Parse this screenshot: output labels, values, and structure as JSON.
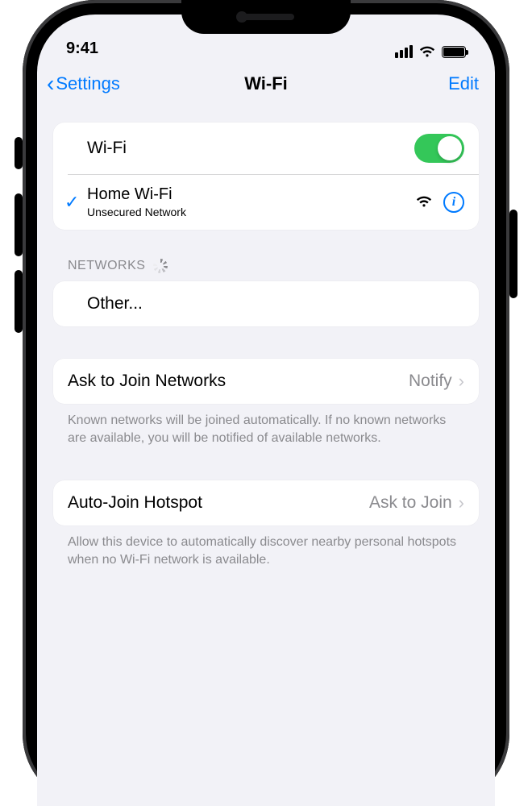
{
  "status": {
    "time": "9:41"
  },
  "nav": {
    "back_label": "Settings",
    "title": "Wi-Fi",
    "edit_label": "Edit"
  },
  "wifi_toggle": {
    "label": "Wi-Fi",
    "on": true
  },
  "connected": {
    "name": "Home Wi-Fi",
    "subtitle": "Unsecured Network"
  },
  "networks_header": "NETWORKS",
  "other_label": "Other...",
  "ask_join": {
    "label": "Ask to Join Networks",
    "value": "Notify",
    "footer": "Known networks will be joined automatically. If no known networks are available, you will be notified of available networks."
  },
  "auto_hotspot": {
    "label": "Auto-Join Hotspot",
    "value": "Ask to Join",
    "footer": "Allow this device to automatically discover nearby personal hotspots when no Wi-Fi network is available."
  }
}
